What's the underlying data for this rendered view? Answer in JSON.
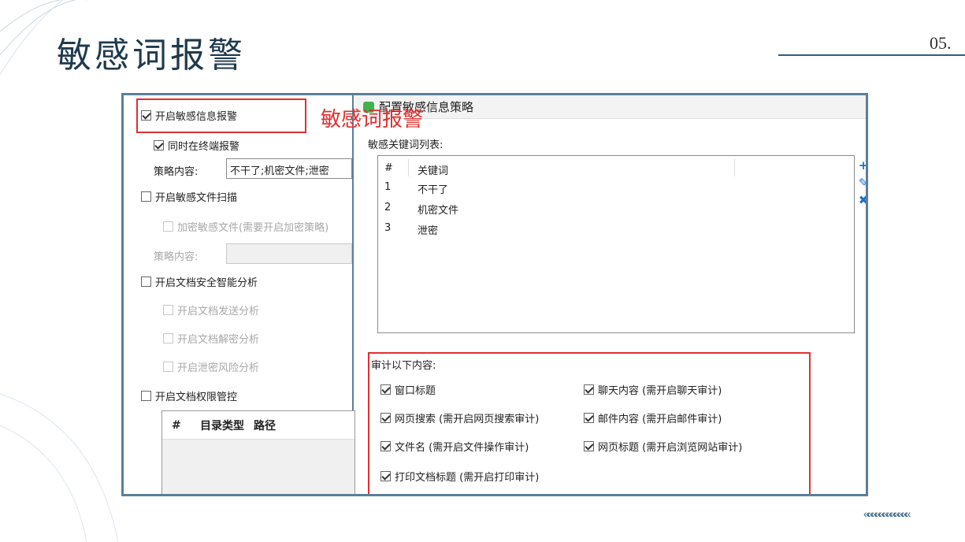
{
  "slide": {
    "title": "敏感词报警",
    "page_number": "05.",
    "chevrons": "««««««««««««"
  },
  "left_panel": {
    "enable_sensitive_alert": {
      "label": "开启敏感信息报警",
      "checked": true
    },
    "terminal_alert": {
      "label": "同时在终端报警",
      "checked": true
    },
    "strategy_label": "策略内容:",
    "strategy_value": "不干了;机密文件;泄密",
    "enable_file_scan": {
      "label": "开启敏感文件扫描",
      "checked": false
    },
    "encrypt_sensitive": {
      "label": "加密敏感文件(需要开启加密策略)",
      "checked": false,
      "disabled": true
    },
    "strategy_label_2": "策略内容:",
    "strategy_value_2": "",
    "enable_doc_analysis": {
      "label": "开启文档安全智能分析",
      "checked": false
    },
    "doc_send_analysis": {
      "label": "开启文档发送分析",
      "checked": false,
      "disabled": true
    },
    "doc_decrypt_analysis": {
      "label": "开启文档解密分析",
      "checked": false,
      "disabled": true
    },
    "leak_risk_analysis": {
      "label": "开启泄密风险分析",
      "checked": false,
      "disabled": true
    },
    "enable_doc_permission": {
      "label": "开启文档权限管控",
      "checked": false
    },
    "perm_table_headers": [
      "#",
      "目录类型",
      "路径"
    ]
  },
  "overlay_title": "敏感词报警",
  "dialog": {
    "title": "配置敏感信息策略",
    "keyword_list_label": "敏感关键词列表:",
    "keyword_headers": {
      "num": "#",
      "word": "关键词"
    },
    "keywords": [
      {
        "num": "1",
        "word": "不干了"
      },
      {
        "num": "2",
        "word": "机密文件"
      },
      {
        "num": "3",
        "word": "泄密"
      }
    ],
    "tools": {
      "add": "+",
      "edit": "✎",
      "delete": "✖"
    },
    "audit_label": "审计以下内容:",
    "audit_items": [
      {
        "label": "窗口标题",
        "checked": true
      },
      {
        "label": "聊天内容 (需开启聊天审计)",
        "checked": true
      },
      {
        "label": "网页搜索 (需开启网页搜索审计)",
        "checked": true
      },
      {
        "label": "邮件内容 (需开启邮件审计)",
        "checked": true
      },
      {
        "label": "文件名 (需开启文件操作审计)",
        "checked": true
      },
      {
        "label": "网页标题 (需开启浏览网站审计)",
        "checked": true
      },
      {
        "label": "打印文档标题 (需开启打印审计)",
        "checked": true
      }
    ]
  },
  "colors": {
    "frame_border": "#5b7f99",
    "highlight_red": "#e03030",
    "tool_blue": "#1a73c8"
  }
}
